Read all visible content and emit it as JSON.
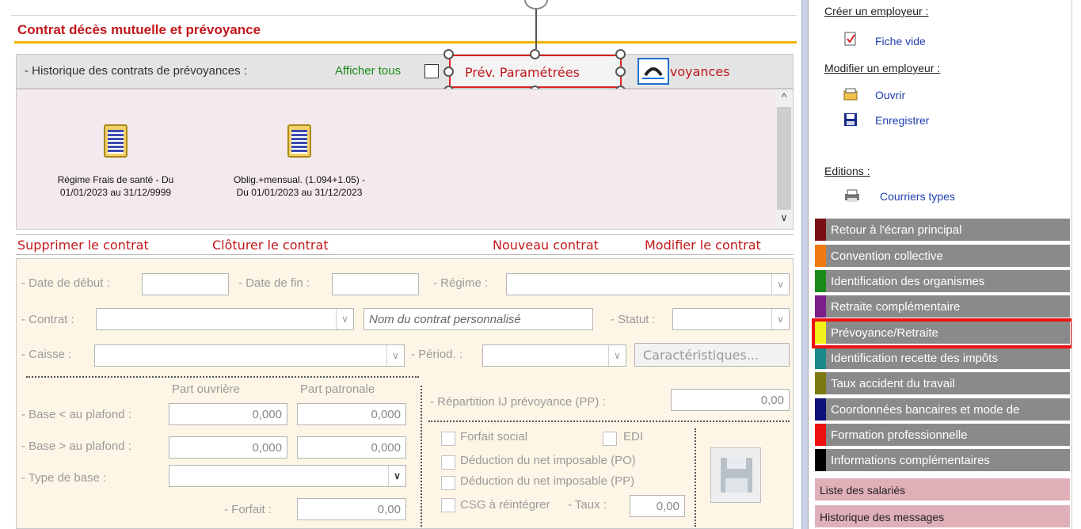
{
  "main": {
    "section_title": "Contrat décès mutuelle et prévoyance",
    "history_label": "- Historique des contrats de prévoyances :",
    "show_all_label": "Afficher tous",
    "prev_param_label": "Prév. Paramétrées",
    "other_prev_label": "s Prévoyances",
    "contracts": [
      {
        "line1": "Régime Frais de santé - Du",
        "line2": "01/01/2023 au 31/12/9999"
      },
      {
        "line1": "Oblig.+mensual. (1.094+1.05) -",
        "line2": "Du 01/01/2023 au 31/12/2023"
      }
    ],
    "actions": {
      "delete": "Supprimer le contrat",
      "close": "Clôturer le contrat",
      "new": "Nouveau contrat",
      "modify": "Modifier le contrat"
    }
  },
  "form": {
    "date_debut_label": "- Date de début :",
    "date_fin_label": "- Date de fin :",
    "regime_label": "- Régime :",
    "contrat_label": "- Contrat :",
    "contrat_placeholder": "Nom du contrat personnalisé",
    "statut_label": "- Statut :",
    "caisse_label": "- Caisse :",
    "periode_label": "- Périod. :",
    "caracteristiques_label": "Caractéristiques...",
    "part_ouvriere_label": "Part ouvrière",
    "part_patronale_label": "Part patronale",
    "base_inf_label": "- Base < au plafond :",
    "base_sup_label": "- Base > au plafond :",
    "type_base_label": "- Type de base :",
    "forfait_label": "- Forfait :",
    "base_inf_ouvr": "0,000",
    "base_inf_patr": "0,000",
    "base_sup_ouvr": "0,000",
    "base_sup_patr": "0,000",
    "forfait_value": "0,00",
    "repartition_label": "- Répartition IJ prévoyance (PP) :",
    "repartition_value": "0,00",
    "forfait_social_label": "Forfait social",
    "edi_label": "EDI",
    "deduction_po_label": "Déduction du net imposable (PO)",
    "deduction_pp_label": "Déduction du net imposable (PP)",
    "csg_label": "CSG à réintégrer",
    "taux_label": "- Taux :",
    "taux_value": "0,00"
  },
  "side": {
    "create_head": "Créer un employeur :",
    "fiche_vide": "Fiche vide",
    "modify_head": "Modifier un employeur :",
    "ouvrir": "Ouvrir",
    "enregistrer": "Enregistrer",
    "editions_head": "Editions :",
    "courriers": "Courriers types",
    "nav": [
      {
        "label": "Retour à l'écran principal",
        "color": "#7a0f14"
      },
      {
        "label": "Convention collective",
        "color": "#f07a12"
      },
      {
        "label": "Identification des organismes",
        "color": "#1a8a1a"
      },
      {
        "label": "Retraite complémentaire",
        "color": "#7a1f8a"
      },
      {
        "label": "Prévoyance/Retraite",
        "color": "#f2f21a"
      },
      {
        "label": "Identification recette des impôts",
        "color": "#1a8a8a"
      },
      {
        "label": "Taux accident du travail",
        "color": "#7a7a10"
      },
      {
        "label": "Coordonnées bancaires et mode de",
        "color": "#10107a"
      },
      {
        "label": "Formation professionnelle",
        "color": "#ee1111"
      },
      {
        "label": "Informations complémentaires",
        "color": "#000000"
      }
    ],
    "liste_salaries": "Liste des salariés",
    "historique_messages": "Historique des messages"
  }
}
